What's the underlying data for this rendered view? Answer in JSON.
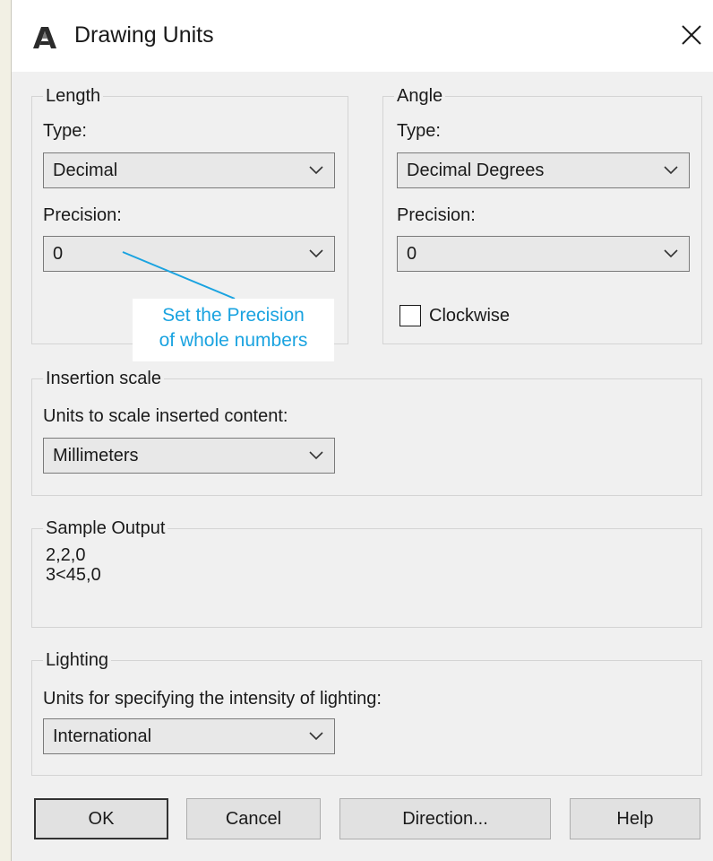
{
  "dialog": {
    "title": "Drawing Units",
    "icons": {
      "app": "autocad-logo-icon",
      "close": "close-icon",
      "dropdown": "chevron-down-icon"
    }
  },
  "length": {
    "legend": "Length",
    "type_label": "Type:",
    "type_value": "Decimal",
    "precision_label": "Precision:",
    "precision_value": "0"
  },
  "angle": {
    "legend": "Angle",
    "type_label": "Type:",
    "type_value": "Decimal Degrees",
    "precision_label": "Precision:",
    "precision_value": "0",
    "clockwise_label": "Clockwise",
    "clockwise_checked": false
  },
  "annotation": {
    "line1": "Set the Precision",
    "line2": "of whole numbers",
    "color": "#1aa3e0"
  },
  "insertion": {
    "legend": "Insertion scale",
    "units_label": "Units to scale inserted content:",
    "units_value": "Millimeters"
  },
  "sample_output": {
    "legend": "Sample Output",
    "line1": "2,2,0",
    "line2": "3<45,0"
  },
  "lighting": {
    "legend": "Lighting",
    "units_label": "Units for specifying the intensity of lighting:",
    "units_value": "International"
  },
  "buttons": {
    "ok": "OK",
    "cancel": "Cancel",
    "direction": "Direction...",
    "help": "Help"
  }
}
